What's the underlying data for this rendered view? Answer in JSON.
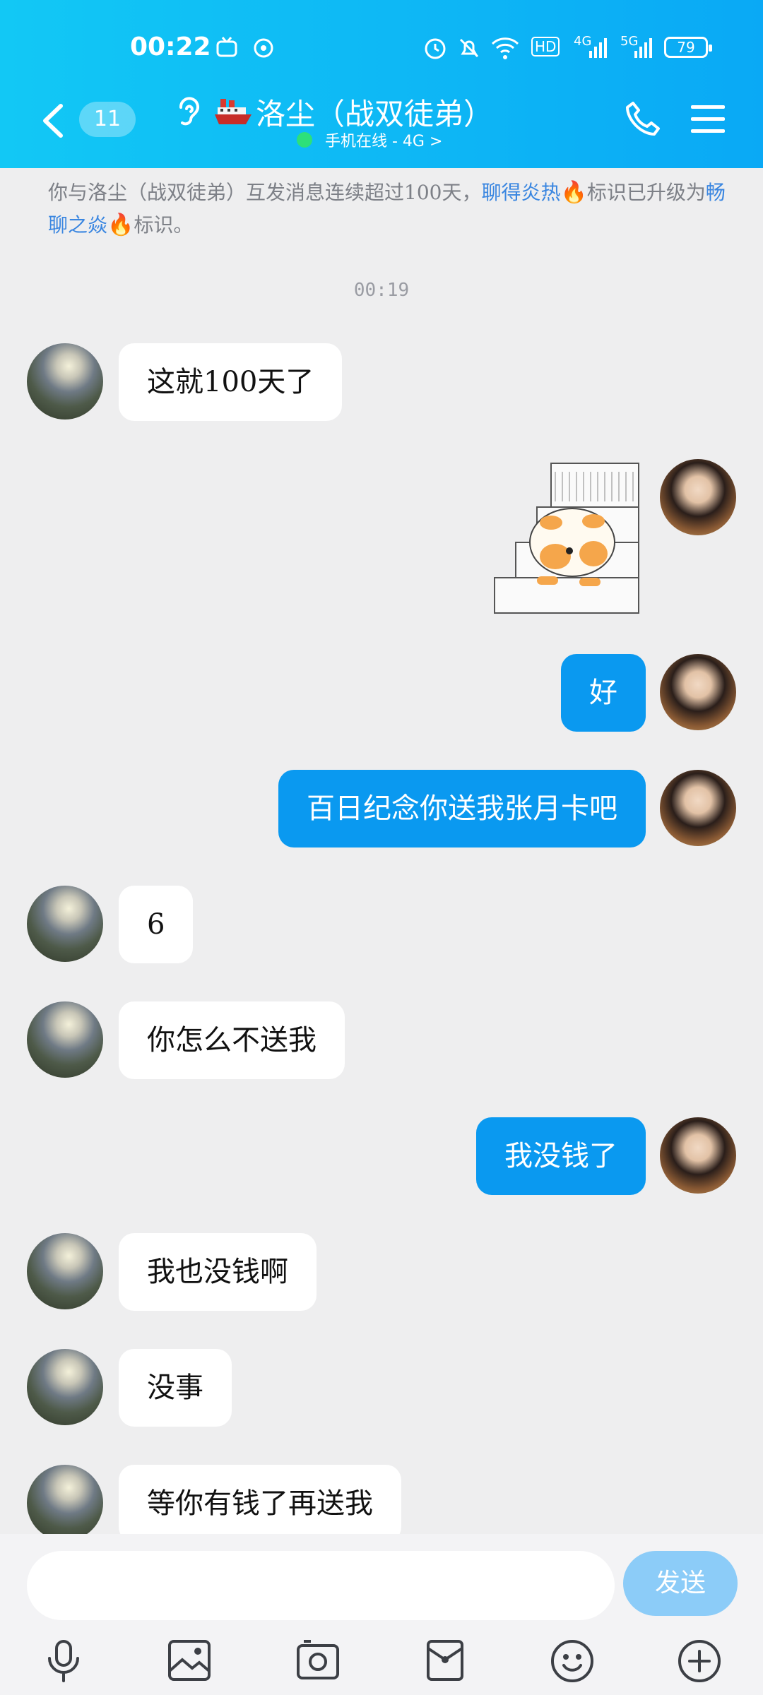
{
  "status_bar": {
    "time": "00:22",
    "network_labels": [
      "HD",
      "4G",
      "5G"
    ],
    "battery": "79"
  },
  "header": {
    "unread_count": "11",
    "title": "洛尘（战双徒弟）",
    "subtitle": "手机在线 - 4G >"
  },
  "notice": {
    "part1": "你与洛尘（战双徒弟）互发消息连续超过100天，",
    "badge1": "聊得炎热",
    "part2": "标识已升级为",
    "badge2": "畅聊之焱",
    "part3": "标识。"
  },
  "timestamp": "00:19",
  "messages": [
    {
      "side": "left",
      "text": "这就100天了"
    },
    {
      "side": "right",
      "type": "sticker"
    },
    {
      "side": "right",
      "text": "好"
    },
    {
      "side": "right",
      "text": "百日纪念你送我张月卡吧"
    },
    {
      "side": "left",
      "text": "6"
    },
    {
      "side": "left",
      "text": "你怎么不送我"
    },
    {
      "side": "right",
      "text": "我没钱了"
    },
    {
      "side": "left",
      "text": "我也没钱啊"
    },
    {
      "side": "left",
      "text": "没事"
    },
    {
      "side": "left",
      "text": "等你有钱了再送我"
    }
  ],
  "composer": {
    "input_value": "",
    "send_label": "发送"
  },
  "toolbar_icons": [
    "mic-icon",
    "image-icon",
    "camera-icon",
    "red-packet-icon",
    "emoji-icon",
    "plus-icon"
  ],
  "colors": {
    "header_start": "#12c8f5",
    "header_end": "#0aa9f5",
    "own_bubble": "#0a99f0",
    "other_bubble": "#ffffff",
    "send_button": "#8cccf8",
    "link": "#3a86e0"
  }
}
